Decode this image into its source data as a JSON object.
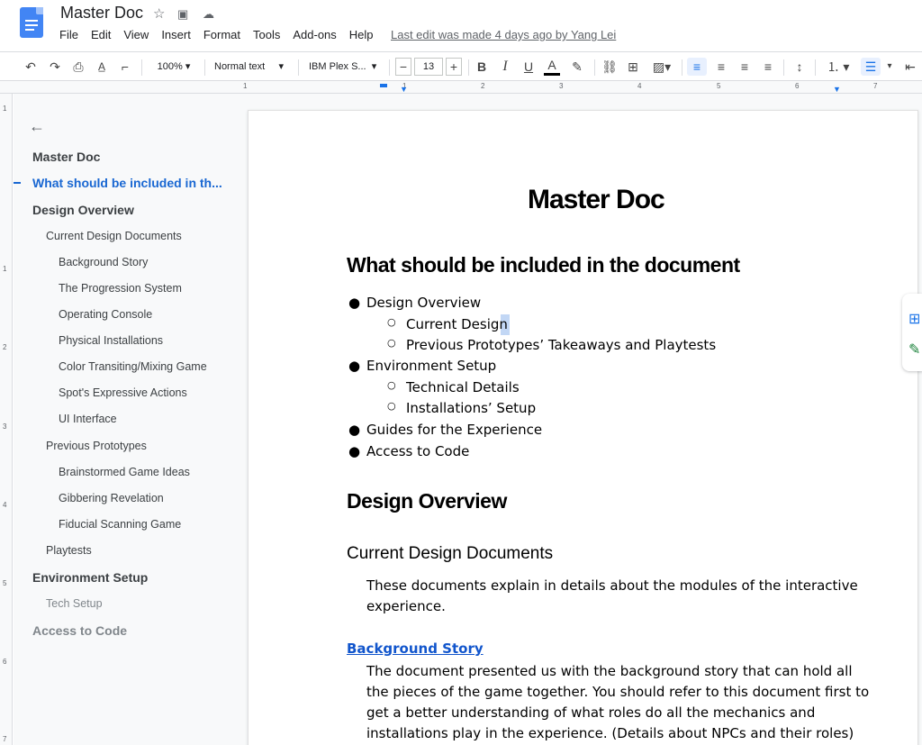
{
  "app": {
    "doc_title": "Master Doc",
    "menu": [
      "File",
      "Edit",
      "View",
      "Insert",
      "Format",
      "Tools",
      "Add-ons",
      "Help"
    ],
    "last_edit": "Last edit was made 4 days ago by Yang Lei"
  },
  "toolbar": {
    "zoom": "100%",
    "style": "Normal text",
    "font": "IBM Plex S...",
    "font_size": "13",
    "bold": "B",
    "italic": "I",
    "underline": "U",
    "text_color": "A"
  },
  "ruler": {
    "h_numbers": [
      "1",
      "1",
      "2",
      "3",
      "4",
      "5",
      "6",
      "7"
    ],
    "v_numbers": [
      "1",
      "1",
      "2",
      "3",
      "4",
      "5",
      "6",
      "7"
    ]
  },
  "outline": {
    "items": [
      {
        "label": "Master Doc"
      },
      {
        "label": "What should be included in th..."
      },
      {
        "label": "Design Overview"
      },
      {
        "label": "Current Design Documents"
      },
      {
        "label": "Background Story"
      },
      {
        "label": "The Progression System"
      },
      {
        "label": "Operating Console"
      },
      {
        "label": "Physical Installations"
      },
      {
        "label": "Color Transiting/Mixing Game"
      },
      {
        "label": "Spot's Expressive Actions"
      },
      {
        "label": "UI Interface"
      },
      {
        "label": "Previous Prototypes"
      },
      {
        "label": "Brainstormed Game Ideas"
      },
      {
        "label": "Gibbering Revelation"
      },
      {
        "label": "Fiducial Scanning Game"
      },
      {
        "label": "Playtests"
      },
      {
        "label": "Environment Setup"
      },
      {
        "label": "Tech Setup"
      },
      {
        "label": "Access to Code"
      }
    ]
  },
  "document": {
    "title": "Master Doc",
    "h1_included": "What should be included in the document",
    "bullets": [
      "Design Overview",
      "Current Design",
      "Previous Prototypes’ Takeaways and Playtests",
      "Environment Setup",
      "Technical Details",
      "Installations’ Setup",
      "Guides for the Experience",
      "Access to Code"
    ],
    "h1_design": "Design Overview",
    "h2_current": "Current Design Documents",
    "para1_line1": "These documents explain in details about the modules of the interactive",
    "para1_line2": "experience.",
    "link_background": "Background Story",
    "para2_lines": [
      "The document presented us with the background story that can hold all",
      "the pieces of the game together.  You should refer to this document first to",
      "get a better understanding of what roles do all the mechanics and",
      "installations play in the experience. (Details about NPCs and their roles)"
    ]
  },
  "colors": {
    "accent": "#1a73e8",
    "outline_active": "#1967d2",
    "link": "#1155cc",
    "doc_logo": "#4285f4"
  }
}
